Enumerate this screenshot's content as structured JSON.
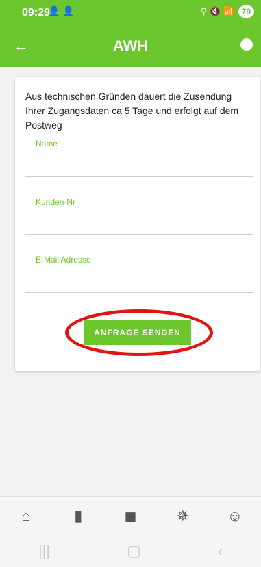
{
  "status": {
    "time": "09:29",
    "battery": "79"
  },
  "appbar": {
    "title": "AWH"
  },
  "info": {
    "text": "Aus technischen Gründen dauert die Zusendung Ihrer Zugangsdaten ca 5 Tage und erfolgt auf dem Postweg"
  },
  "form": {
    "name_label": "Name",
    "customer_label": "Kunden-Nr",
    "email_label": "E-Mail Adresse",
    "submit_label": "ANFRAGE SENDEN"
  },
  "colors": {
    "brand": "#6cc62e",
    "annotation": "#e11414"
  },
  "bottom_nav": [
    "home-icon",
    "tower-icon",
    "meter-icon",
    "network-icon",
    "users-icon"
  ]
}
